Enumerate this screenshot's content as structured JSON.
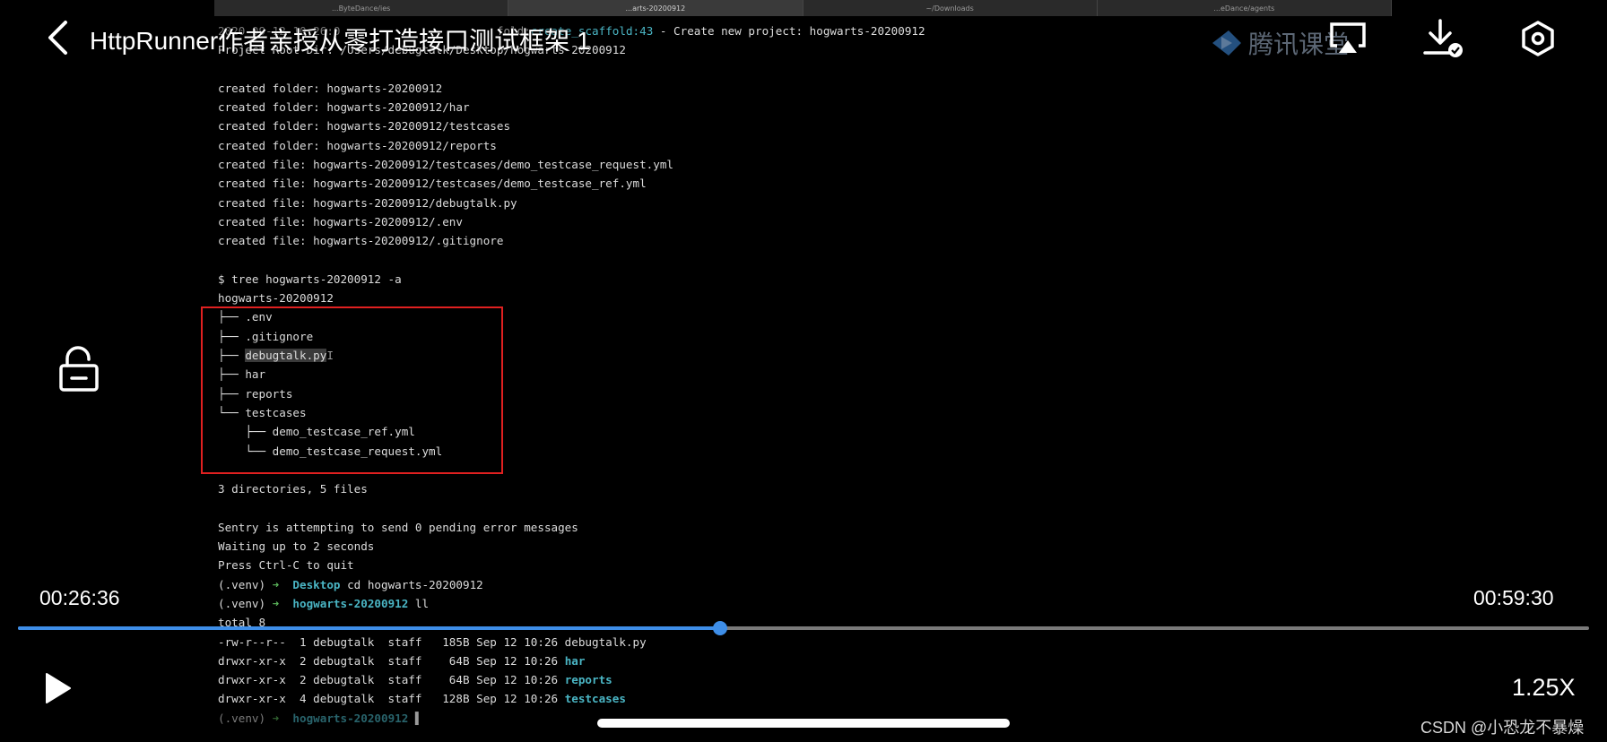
{
  "terminal_tabs": [
    "...ByteDance/ies",
    "...arts-20200912",
    "~/Downloads",
    "...eDance/agents"
  ],
  "terminal_lines": [
    {
      "segments": [
        {
          "text": "2020-09-12 10:26:0",
          "cls": "faded"
        },
        {
          "text": "                       ",
          "cls": ""
        },
        {
          "text": "fold:",
          "cls": "dim"
        },
        {
          "text": "create_scaffold",
          "cls": "cyan"
        },
        {
          "text": ":43",
          "cls": "cyan"
        },
        {
          "text": " - Create new project: hogwarts-20200912",
          "cls": ""
        }
      ]
    },
    {
      "segments": [
        {
          "text": "Project Root Dir: /Users/debugtalk/Desktop/hogwarts-20200912",
          "cls": ""
        }
      ]
    },
    {
      "segments": [
        {
          "text": "",
          "cls": ""
        }
      ]
    },
    {
      "segments": [
        {
          "text": "created folder: hogwarts-20200912",
          "cls": ""
        }
      ]
    },
    {
      "segments": [
        {
          "text": "created folder: hogwarts-20200912/har",
          "cls": ""
        }
      ]
    },
    {
      "segments": [
        {
          "text": "created folder: hogwarts-20200912/testcases",
          "cls": ""
        }
      ]
    },
    {
      "segments": [
        {
          "text": "created folder: hogwarts-20200912/reports",
          "cls": ""
        }
      ]
    },
    {
      "segments": [
        {
          "text": "created file: hogwarts-20200912/testcases/demo_testcase_request.yml",
          "cls": ""
        }
      ]
    },
    {
      "segments": [
        {
          "text": "created file: hogwarts-20200912/testcases/demo_testcase_ref.yml",
          "cls": ""
        }
      ]
    },
    {
      "segments": [
        {
          "text": "created file: hogwarts-20200912/debugtalk.py",
          "cls": ""
        }
      ]
    },
    {
      "segments": [
        {
          "text": "created file: hogwarts-20200912/.env",
          "cls": ""
        }
      ]
    },
    {
      "segments": [
        {
          "text": "created file: hogwarts-20200912/.gitignore",
          "cls": ""
        }
      ]
    },
    {
      "segments": [
        {
          "text": "",
          "cls": ""
        }
      ]
    },
    {
      "segments": [
        {
          "text": "$ tree hogwarts-20200912 -a",
          "cls": ""
        }
      ]
    },
    {
      "segments": [
        {
          "text": "hogwarts-20200912",
          "cls": ""
        }
      ]
    },
    {
      "segments": [
        {
          "text": "├── .env",
          "cls": ""
        }
      ]
    },
    {
      "segments": [
        {
          "text": "├── .gitignore",
          "cls": ""
        }
      ]
    },
    {
      "segments": [
        {
          "text": "├── ",
          "cls": ""
        },
        {
          "text": "debugtalk.py",
          "cls": "hl"
        },
        {
          "text": "I",
          "cls": "dim"
        }
      ]
    },
    {
      "segments": [
        {
          "text": "├── har",
          "cls": ""
        }
      ]
    },
    {
      "segments": [
        {
          "text": "├── reports",
          "cls": ""
        }
      ]
    },
    {
      "segments": [
        {
          "text": "└── testcases",
          "cls": ""
        }
      ]
    },
    {
      "segments": [
        {
          "text": "    ├── demo_testcase_ref.yml",
          "cls": ""
        }
      ]
    },
    {
      "segments": [
        {
          "text": "    └── demo_testcase_request.yml",
          "cls": ""
        }
      ]
    },
    {
      "segments": [
        {
          "text": "",
          "cls": ""
        }
      ]
    },
    {
      "segments": [
        {
          "text": "3 directories, 5 files",
          "cls": ""
        }
      ]
    },
    {
      "segments": [
        {
          "text": "",
          "cls": ""
        }
      ]
    },
    {
      "segments": [
        {
          "text": "Sentry is attempting to send 0 pending error messages",
          "cls": ""
        }
      ]
    },
    {
      "segments": [
        {
          "text": "Waiting up to 2 seconds",
          "cls": ""
        }
      ]
    },
    {
      "segments": [
        {
          "text": "Press Ctrl-C to quit",
          "cls": ""
        }
      ]
    },
    {
      "segments": [
        {
          "text": "(.venv) ",
          "cls": ""
        },
        {
          "text": "➜ ",
          "cls": "green"
        },
        {
          "text": " Desktop",
          "cls": "bold-cyan"
        },
        {
          "text": " cd hogwarts-20200912",
          "cls": ""
        }
      ]
    },
    {
      "segments": [
        {
          "text": "(.venv) ",
          "cls": ""
        },
        {
          "text": "➜ ",
          "cls": "green"
        },
        {
          "text": " hogwarts-20200912",
          "cls": "bold-cyan"
        },
        {
          "text": " ll",
          "cls": ""
        }
      ]
    },
    {
      "segments": [
        {
          "text": "total 8",
          "cls": ""
        }
      ]
    },
    {
      "segments": [
        {
          "text": "-rw-r--r--  1 debugtalk  staff   185B Sep 12 10:26 debugtalk.py",
          "cls": ""
        }
      ]
    },
    {
      "segments": [
        {
          "text": "drwxr-xr-x  2 debugtalk  staff    64B Sep 12 10:26 ",
          "cls": ""
        },
        {
          "text": "har",
          "cls": "bold-cyan"
        }
      ]
    },
    {
      "segments": [
        {
          "text": "drwxr-xr-x  2 debugtalk  staff    64B Sep 12 10:26 ",
          "cls": ""
        },
        {
          "text": "reports",
          "cls": "bold-cyan"
        }
      ]
    },
    {
      "segments": [
        {
          "text": "drwxr-xr-x  4 debugtalk  staff   128B Sep 12 10:26 ",
          "cls": ""
        },
        {
          "text": "testcases",
          "cls": "bold-cyan"
        }
      ]
    },
    {
      "segments": [
        {
          "text": "(.venv) ",
          "cls": "faded"
        },
        {
          "text": "➜ ",
          "cls": "green faded"
        },
        {
          "text": " hogwarts-20200912",
          "cls": "bold-cyan faded"
        },
        {
          "text": " ▌",
          "cls": "dim"
        }
      ]
    }
  ],
  "header": {
    "title": "HttpRunner作者亲授从零打造接口测试框架 1",
    "brand": "腾讯课堂"
  },
  "player": {
    "current_time": "00:26:36",
    "total_time": "00:59:30",
    "progress_fraction": 0.447,
    "speed": "1.25X"
  },
  "watermark": "CSDN @小恐龙不暴燥",
  "icons": {
    "back": "chevron-left-icon",
    "cast": "airplay-icon",
    "download": "download-icon",
    "settings": "settings-icon",
    "lock": "unlock-icon",
    "play": "play-icon"
  },
  "colors": {
    "accent": "#3e8ee8",
    "highlight_box": "#e02020"
  }
}
